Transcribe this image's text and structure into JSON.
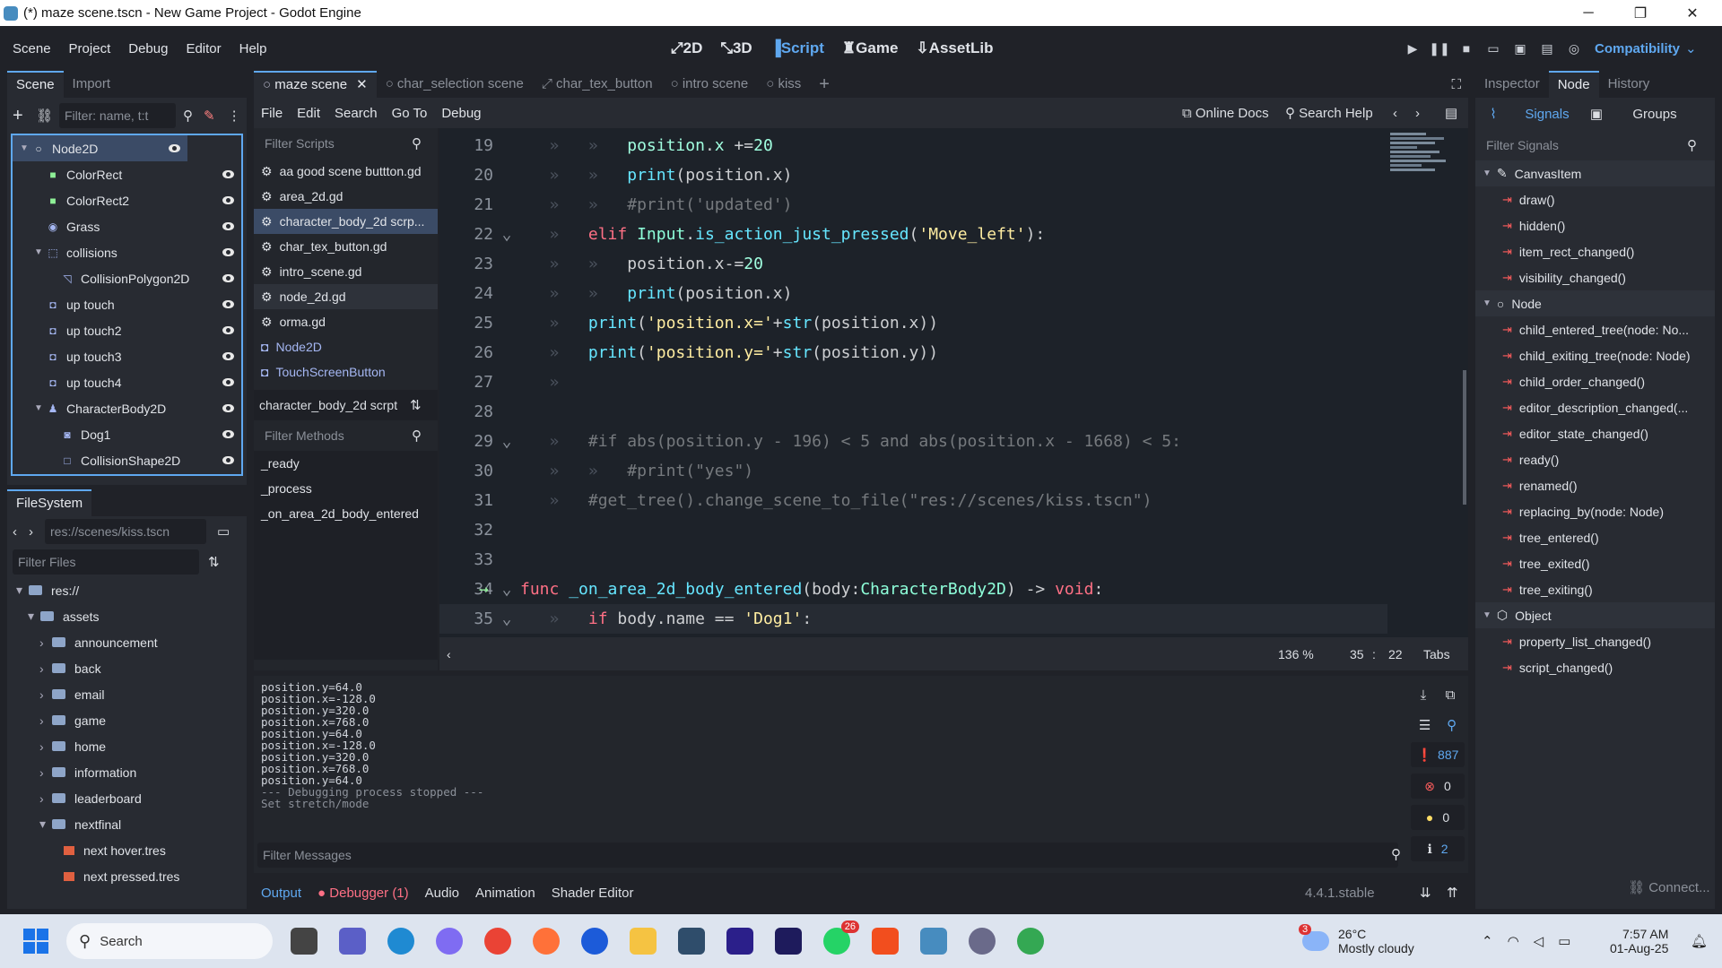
{
  "window": {
    "title": "(*) maze scene.tscn - New Game Project - Godot Engine",
    "minimize": "─",
    "maximize": "❐",
    "close": "✕"
  },
  "menu": [
    "Scene",
    "Project",
    "Debug",
    "Editor",
    "Help"
  ],
  "workspaces": [
    {
      "label": "2D",
      "icon": "⤢"
    },
    {
      "label": "3D",
      "icon": "⤡"
    },
    {
      "label": "Script",
      "icon": "▐"
    },
    {
      "label": "Game",
      "icon": "♜"
    },
    {
      "label": "AssetLib",
      "icon": "⇩"
    }
  ],
  "renderer": "Compatibility",
  "scene_dock": {
    "tabs": [
      "Scene",
      "Import"
    ],
    "filter_placeholder": "Filter: name, t:t",
    "nodes": [
      {
        "label": "Node2D",
        "icon": "○",
        "color": "#e0e3e8",
        "depth": 0,
        "selected": true
      },
      {
        "label": "ColorRect",
        "icon": "■",
        "color": "#8eef97",
        "depth": 1
      },
      {
        "label": "ColorRect2",
        "icon": "■",
        "color": "#8eef97",
        "depth": 1
      },
      {
        "label": "Grass",
        "icon": "◉",
        "color": "#a5b7f3",
        "depth": 1
      },
      {
        "label": "collisions",
        "icon": "⬚",
        "color": "#a5b7f3",
        "depth": 1
      },
      {
        "label": "CollisionPolygon2D",
        "icon": "◹",
        "color": "#a5b7f3",
        "depth": 2
      },
      {
        "label": "up touch",
        "icon": "◘",
        "color": "#a5b7f3",
        "depth": 1
      },
      {
        "label": "up touch2",
        "icon": "◘",
        "color": "#a5b7f3",
        "depth": 1
      },
      {
        "label": "up touch3",
        "icon": "◘",
        "color": "#a5b7f3",
        "depth": 1
      },
      {
        "label": "up touch4",
        "icon": "◘",
        "color": "#a5b7f3",
        "depth": 1
      },
      {
        "label": "CharacterBody2D",
        "icon": "♟",
        "color": "#a5b7f3",
        "depth": 1
      },
      {
        "label": "Dog1",
        "icon": "◙",
        "color": "#a5b7f3",
        "depth": 2
      },
      {
        "label": "CollisionShape2D",
        "icon": "□",
        "color": "#a5b7f3",
        "depth": 2
      }
    ]
  },
  "filesystem": {
    "tab": "FileSystem",
    "path": "res://scenes/kiss.tscn",
    "filter_placeholder": "Filter Files",
    "items": [
      {
        "label": "res://",
        "depth": 0
      },
      {
        "label": "assets",
        "depth": 1
      },
      {
        "label": "announcement",
        "depth": 2
      },
      {
        "label": "back",
        "depth": 2
      },
      {
        "label": "email",
        "depth": 2
      },
      {
        "label": "game",
        "depth": 2
      },
      {
        "label": "home",
        "depth": 2
      },
      {
        "label": "information",
        "depth": 2
      },
      {
        "label": "leaderboard",
        "depth": 2
      },
      {
        "label": "nextfinal",
        "depth": 2
      },
      {
        "label": "next hover.tres",
        "depth": 3,
        "file": true
      },
      {
        "label": "next pressed.tres",
        "depth": 3,
        "file": true
      }
    ]
  },
  "scene_tabs": [
    "maze scene",
    "char_selection scene",
    "char_tex_button",
    "intro scene",
    "kiss"
  ],
  "script_menu": [
    "File",
    "Edit",
    "Search",
    "Go To",
    "Debug"
  ],
  "script_tools": {
    "online_docs": "Online Docs",
    "search_help": "Search Help"
  },
  "scripts": {
    "filter_placeholder": "Filter Scripts",
    "items": [
      "aa good scene buttton.gd",
      "area_2d.gd",
      "character_body_2d scrp...",
      "char_tex_button.gd",
      "intro_scene.gd",
      "node_2d.gd",
      "orma.gd",
      "Node2D",
      "TouchScreenButton"
    ],
    "current": "character_body_2d scrpt"
  },
  "methods": {
    "filter_placeholder": "Filter Methods",
    "items": [
      "_ready",
      "_process",
      "_on_area_2d_body_entered"
    ]
  },
  "code_lines": [
    "19",
    "20",
    "21",
    "22",
    "23",
    "24",
    "25",
    "26",
    "27",
    "28",
    "29",
    "30",
    "31",
    "32",
    "33",
    "34",
    "35"
  ],
  "status": {
    "zoom": "136 %",
    "line": "35",
    "col": "22",
    "indent": "Tabs",
    "sep": ":"
  },
  "output": {
    "lines": [
      "position.y=64.0",
      "position.x=-128.0",
      "position.y=320.0",
      "position.x=768.0",
      "position.y=64.0",
      "position.x=-128.0",
      "position.y=320.0",
      "position.x=768.0",
      "position.y=64.0",
      "--- Debugging process stopped ---",
      "Set stretch/mode"
    ],
    "filter_placeholder": "Filter Messages",
    "counts": {
      "messages": "887",
      "errors": "0",
      "warnings": "0",
      "info": "2"
    }
  },
  "bottom_tabs": {
    "output": "Output",
    "debugger": "Debugger (1)",
    "audio": "Audio",
    "animation": "Animation",
    "shader": "Shader Editor",
    "version": "4.4.1.stable"
  },
  "inspector": {
    "tabs": [
      "Inspector",
      "Node",
      "History"
    ],
    "sub_tabs": [
      "Signals",
      "Groups"
    ],
    "filter_placeholder": "Filter Signals",
    "groups": [
      {
        "name": "CanvasItem",
        "signals": [
          "draw()",
          "hidden()",
          "item_rect_changed()",
          "visibility_changed()"
        ]
      },
      {
        "name": "Node",
        "signals": [
          "child_entered_tree(node: No...",
          "child_exiting_tree(node: Node)",
          "child_order_changed()",
          "editor_description_changed(...",
          "editor_state_changed()",
          "ready()",
          "renamed()",
          "replacing_by(node: Node)",
          "tree_entered()",
          "tree_exited()",
          "tree_exiting()"
        ]
      },
      {
        "name": "Object",
        "signals": [
          "property_list_changed()",
          "script_changed()"
        ]
      }
    ],
    "connect": "Connect..."
  },
  "taskbar": {
    "search": "Search",
    "weather_temp": "26°C",
    "weather_text": "Mostly cloudy",
    "weather_badge": "3",
    "whatsapp_badge": "26",
    "time": "7:57 AM",
    "date": "01-Aug-25"
  }
}
